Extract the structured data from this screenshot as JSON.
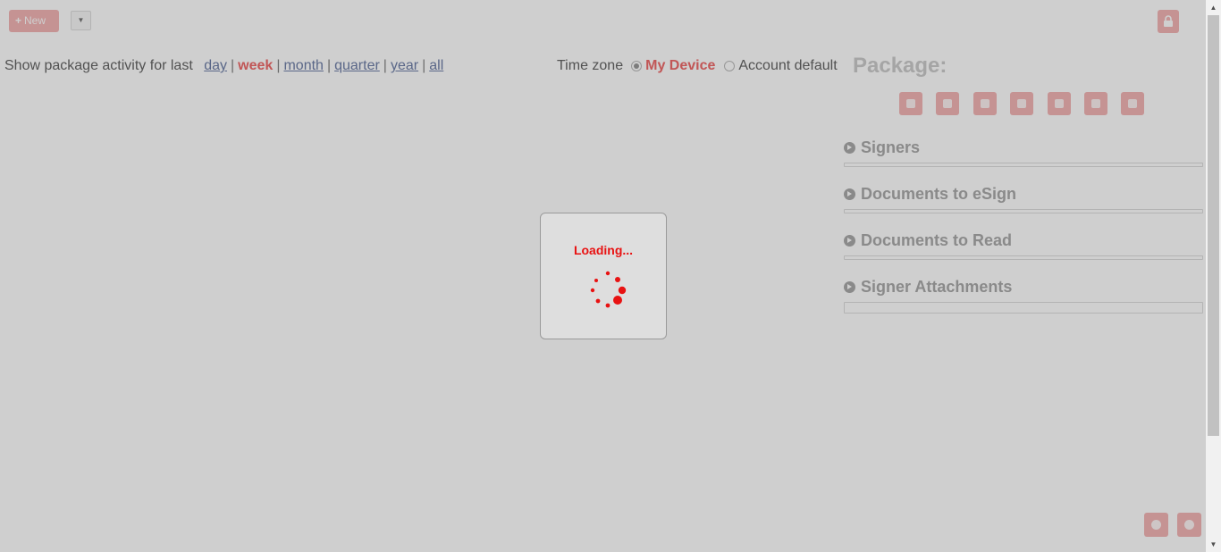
{
  "toolbar": {
    "new_label": "New",
    "dropdown_glyph": "▼"
  },
  "activity": {
    "label": "Show package activity for last",
    "options": [
      "day",
      "week",
      "month",
      "quarter",
      "year",
      "all"
    ],
    "selected": "week"
  },
  "timezone": {
    "label": "Time zone",
    "options": [
      "My Device",
      "Account default"
    ],
    "selected": "My Device"
  },
  "package": {
    "title": "Package:",
    "tool_icons": [
      "left-arrow-icon",
      "right-arrow-icon",
      "cloud-upload-icon",
      "settings-icon",
      "search-icon",
      "copy-icon",
      "delete-icon"
    ],
    "sections": [
      "Signers",
      "Documents to eSign",
      "Documents to Read",
      "Signer Attachments"
    ]
  },
  "loading": {
    "text": "Loading..."
  },
  "colors": {
    "accent": "#e81212",
    "accent_faded": "#f3b5b5",
    "overlay": "rgba(0,0,0,0.19)"
  }
}
